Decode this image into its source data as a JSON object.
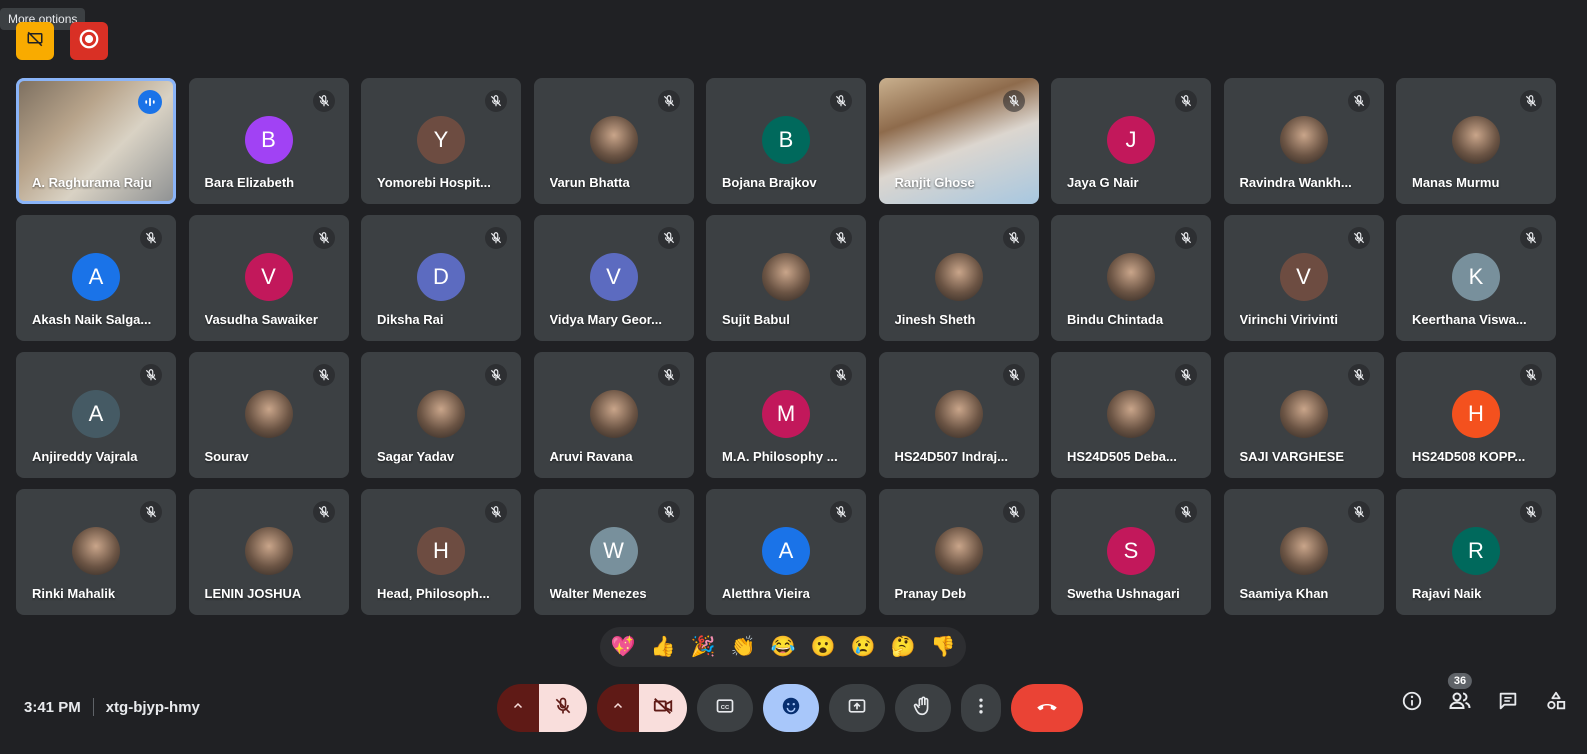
{
  "tooltip": "More options",
  "colors": {
    "background": "#202124",
    "tile": "#3c4043",
    "accent": "#8ab4f8",
    "hangup": "#ea4335"
  },
  "top_badges": [
    {
      "icon": "screen-share-off-icon",
      "color": "#f9ab00"
    },
    {
      "icon": "record-icon",
      "color": "#d93025"
    }
  ],
  "participants": [
    {
      "name": "A. Raghurama Raju",
      "type": "video",
      "speaking": true
    },
    {
      "name": "Bara Elizabeth",
      "type": "initial",
      "initial": "B",
      "color": "#a142f4"
    },
    {
      "name": "Yomorebi Hospit...",
      "type": "initial",
      "initial": "Y",
      "color": "#6d4c41"
    },
    {
      "name": "Varun Bhatta",
      "type": "photo"
    },
    {
      "name": "Bojana Brajkov",
      "type": "initial",
      "initial": "B",
      "color": "#00695c"
    },
    {
      "name": "Ranjit Ghose",
      "type": "video2"
    },
    {
      "name": "Jaya G Nair",
      "type": "initial",
      "initial": "J",
      "color": "#c2185b"
    },
    {
      "name": "Ravindra Wankh...",
      "type": "photo"
    },
    {
      "name": "Manas Murmu",
      "type": "photo"
    },
    {
      "name": "Akash Naik Salga...",
      "type": "initial",
      "initial": "A",
      "color": "#1a73e8"
    },
    {
      "name": "Vasudha Sawaiker",
      "type": "initial",
      "initial": "V",
      "color": "#c2185b"
    },
    {
      "name": "Diksha Rai",
      "type": "initial",
      "initial": "D",
      "color": "#5c6bc0"
    },
    {
      "name": "Vidya Mary Geor...",
      "type": "initial",
      "initial": "V",
      "color": "#5c6bc0"
    },
    {
      "name": "Sujit Babul",
      "type": "photo"
    },
    {
      "name": "Jinesh Sheth",
      "type": "photo"
    },
    {
      "name": "Bindu Chintada",
      "type": "photo"
    },
    {
      "name": "Virinchi Virivinti",
      "type": "initial",
      "initial": "V",
      "color": "#6d4c41"
    },
    {
      "name": "Keerthana Viswa...",
      "type": "initial",
      "initial": "K",
      "color": "#78909c"
    },
    {
      "name": "Anjireddy Vajrala",
      "type": "initial",
      "initial": "A",
      "color": "#455a64"
    },
    {
      "name": "Sourav",
      "type": "photo"
    },
    {
      "name": "Sagar Yadav",
      "type": "photo"
    },
    {
      "name": "Aruvi Ravana",
      "type": "photo"
    },
    {
      "name": "M.A. Philosophy ...",
      "type": "initial",
      "initial": "M",
      "color": "#c2185b"
    },
    {
      "name": "HS24D507 Indraj...",
      "type": "photo"
    },
    {
      "name": "HS24D505 Deba...",
      "type": "photo"
    },
    {
      "name": "SAJI VARGHESE",
      "type": "photo"
    },
    {
      "name": "HS24D508 KOPP...",
      "type": "initial",
      "initial": "H",
      "color": "#f4511e"
    },
    {
      "name": "Rinki Mahalik",
      "type": "photo"
    },
    {
      "name": "LENIN JOSHUA",
      "type": "photo"
    },
    {
      "name": "Head, Philosoph...",
      "type": "initial",
      "initial": "H",
      "color": "#6d4c41"
    },
    {
      "name": "Walter Menezes",
      "type": "initial",
      "initial": "W",
      "color": "#78909c"
    },
    {
      "name": "Aletthra Vieira",
      "type": "initial",
      "initial": "A",
      "color": "#1a73e8"
    },
    {
      "name": "Pranay Deb",
      "type": "photo"
    },
    {
      "name": "Swetha Ushnagari",
      "type": "initial",
      "initial": "S",
      "color": "#c2185b"
    },
    {
      "name": "Saamiya Khan",
      "type": "photo"
    },
    {
      "name": "Rajavi Naik",
      "type": "initial",
      "initial": "R",
      "color": "#00695c"
    }
  ],
  "reactions": [
    "💖",
    "👍",
    "🎉",
    "👏",
    "😂",
    "😮",
    "😢",
    "🤔",
    "👎"
  ],
  "meeting": {
    "time": "3:41 PM",
    "code": "xtg-bjyp-hmy"
  },
  "people_count": "36"
}
